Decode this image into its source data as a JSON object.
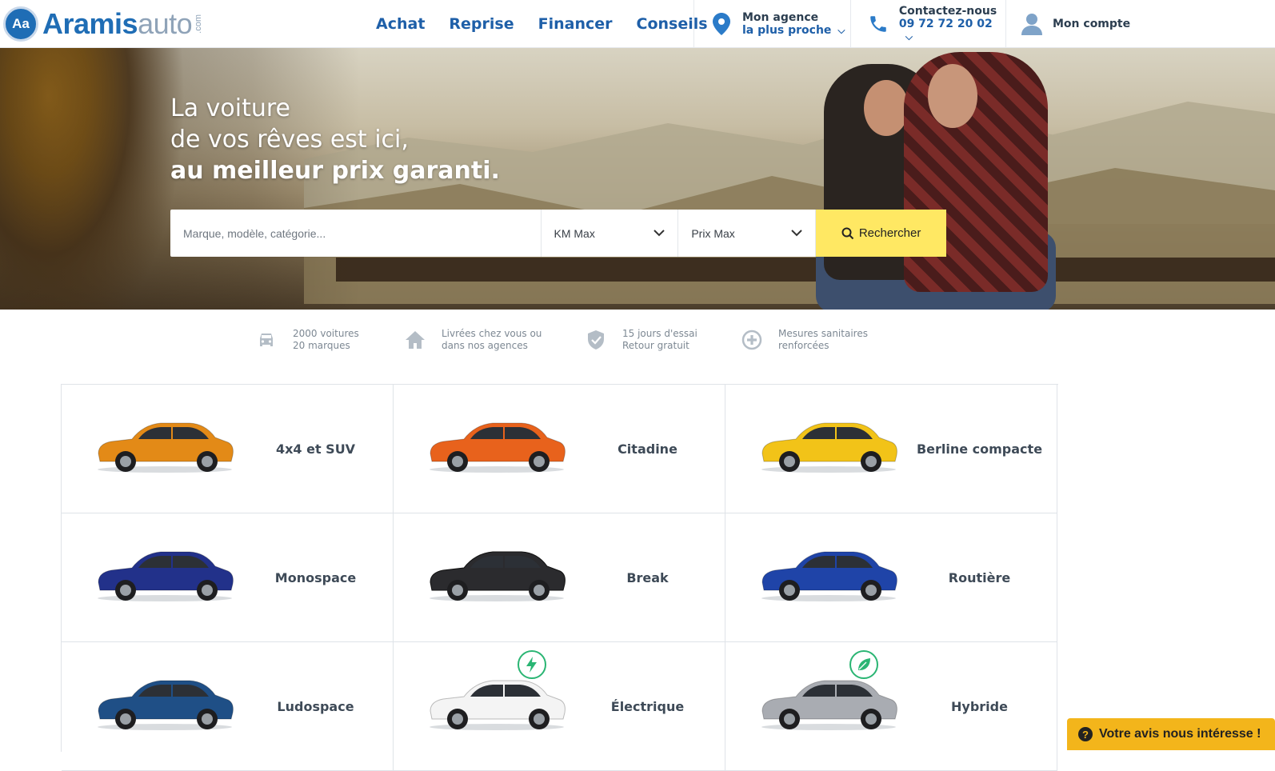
{
  "header": {
    "logo_badge": "Aa",
    "logo_part1": "Aramis",
    "logo_part2": "auto",
    "logo_suffix": ".com",
    "nav": [
      "Achat",
      "Reprise",
      "Financer",
      "Conseils"
    ],
    "agency_line1": "Mon agence",
    "agency_line2": "la plus proche",
    "contact_line1": "Contactez-nous",
    "contact_line2": "09 72 72 20 02",
    "account": "Mon compte"
  },
  "hero": {
    "line1": "La voiture",
    "line2": "de vos rêves est ici,",
    "line3": "au meilleur prix garanti."
  },
  "search": {
    "placeholder": "Marque, modèle, catégorie...",
    "km": "KM Max",
    "price": "Prix Max",
    "button": "Rechercher"
  },
  "features": [
    {
      "line1": "2000 voitures",
      "line2": "20 marques",
      "icon": "car-icon"
    },
    {
      "line1": "Livrées chez vous ou",
      "line2": "dans nos agences",
      "icon": "home-icon"
    },
    {
      "line1": "15 jours d'essai",
      "line2": "Retour gratuit",
      "icon": "shield-check-icon"
    },
    {
      "line1": "Mesures sanitaires",
      "line2": "renforcées",
      "icon": "plus-circle-icon"
    }
  ],
  "categories": [
    {
      "label": "4x4 et SUV",
      "color": "#e38a17"
    },
    {
      "label": "Citadine",
      "color": "#e8621c"
    },
    {
      "label": "Berline compacte",
      "color": "#f2c318"
    },
    {
      "label": "Monospace",
      "color": "#22318a"
    },
    {
      "label": "Break",
      "color": "#2b2b2e"
    },
    {
      "label": "Routière",
      "color": "#1f44a8"
    },
    {
      "label": "Ludospace",
      "color": "#1f4f86"
    },
    {
      "label": "Électrique",
      "color": "#f4f4f4"
    },
    {
      "label": "Hybride",
      "color": "#a9acb2"
    }
  ],
  "feedback": "Votre avis nous intéresse !",
  "colors": {
    "accent": "#1e5fa8",
    "search_button": "#ffe863",
    "feedback": "#f3b51b",
    "eco_badge": "#2ab573"
  }
}
